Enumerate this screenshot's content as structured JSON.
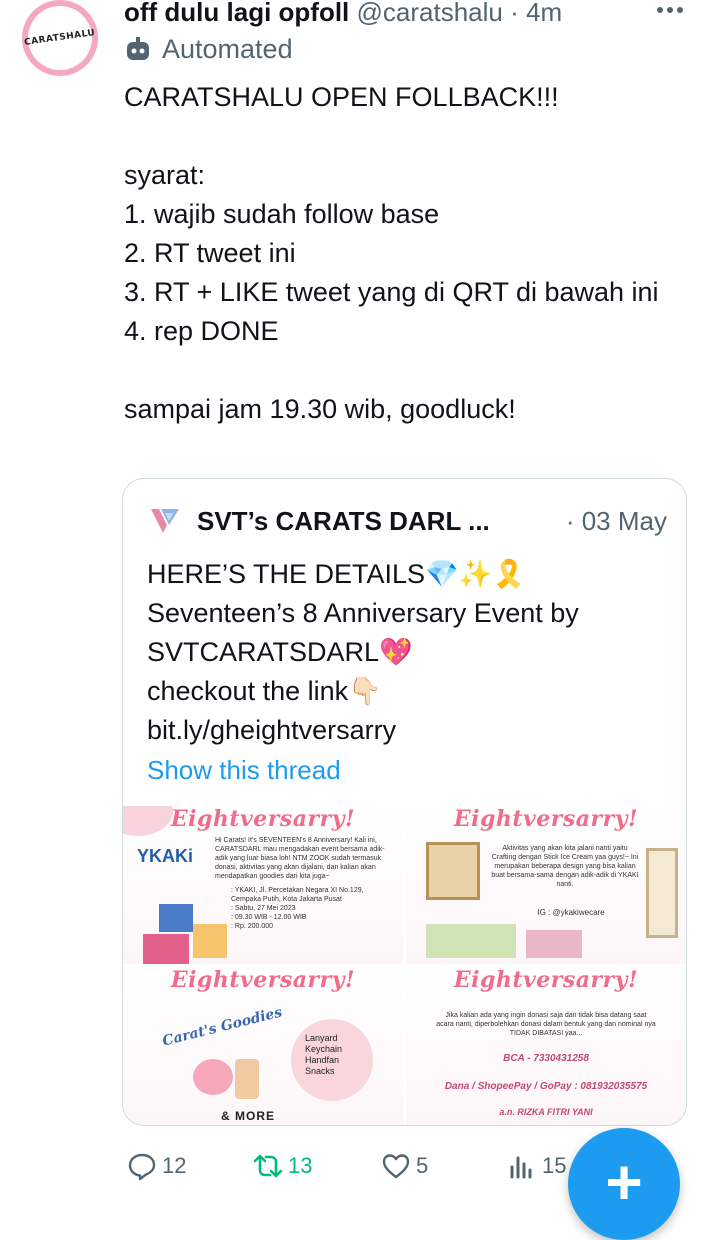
{
  "tweet": {
    "avatar_text": "CARATSHALU",
    "display_name": "off dulu lagi opfoll",
    "handle": "@caratshalu",
    "time": " · 4m",
    "automated_label": "Automated",
    "text": "CARATSHALU OPEN FOLLBACK!!!\n\nsyarat:\n1. wajib sudah follow base\n2. RT tweet ini\n3. RT + LIKE tweet yang di QRT di bawah ini\n4. rep DONE\n\nsampai jam 19.30 wib, goodluck!"
  },
  "quote": {
    "display_name": "SVT’s CARATS DARL ...",
    "date": "· 03 May",
    "text": "HERE’S THE DETAILS💎✨🎗️\nSeventeen’s 8 Anniversary Event by SVTCARATSDARL💖\ncheckout the link👇🏻\nbit.ly/gheightversarry",
    "show_thread": "Show this thread",
    "images": {
      "p1": {
        "title": "Eightversarry!",
        "logo": "YKAKi",
        "intro": "Hi Carats! It's SEVENTEEN's 8 Anniversary! Kali ini, CARATSDARL mau mengadakan event bersama adik-adik yang luar biasa loh! NTM ZOOK sudah termasuk donasi, aktivitas yang akan dijalani, dan kalian akan mendapatkan goodies dari kita juga~",
        "details": ": YKAKI, Jl. Percetakan Negara XI No.129, Cempaka Putih, Kota Jakarta Pusat\n: Sabtu, 27 Mei 2023\n: 09.30 WIB - 12.00 WIB\n: Rp. 200.000"
      },
      "p2": {
        "title": "Eightversarry!",
        "body": "Aktivitas yang akan kita jalani nanti yaitu Crafting dengan Stick Ice Cream yaa guys!~ Ini merupakan beberapa design yang bisa kalian buat bersama-sama dengan adik-adik di YKAKI nanti.",
        "ig": "IG : @ykakiwecare"
      },
      "p3": {
        "title": "Eightversarry!",
        "goodies_title": "Carat's Goodies",
        "items": [
          "Lanyard",
          "Keychain",
          "Handfan",
          "Snacks"
        ],
        "more": "& MORE"
      },
      "p4": {
        "title": "Eightversarry!",
        "body": "Jika kalian ada yang ingin donasi saja dan tidak bisa datang saat acara nanti, diperbolehkan donasi dalam bentuk yang dan nominal nya TIDAK DIBATASI yaa...",
        "bca": "BCA - 7330431258",
        "ewallet": "Dana / ShopeePay / GoPay : 081932035575",
        "name": "a.n. RIZKA FITRI YANI"
      }
    }
  },
  "actions": {
    "reply_count": "12",
    "retweet_count": "13",
    "like_count": "5",
    "views_count": "15"
  },
  "colors": {
    "accent": "#1d9bf0",
    "retweet": "#00ba7c",
    "secondary_text": "#536471",
    "panel_title": "#f06c8a"
  }
}
